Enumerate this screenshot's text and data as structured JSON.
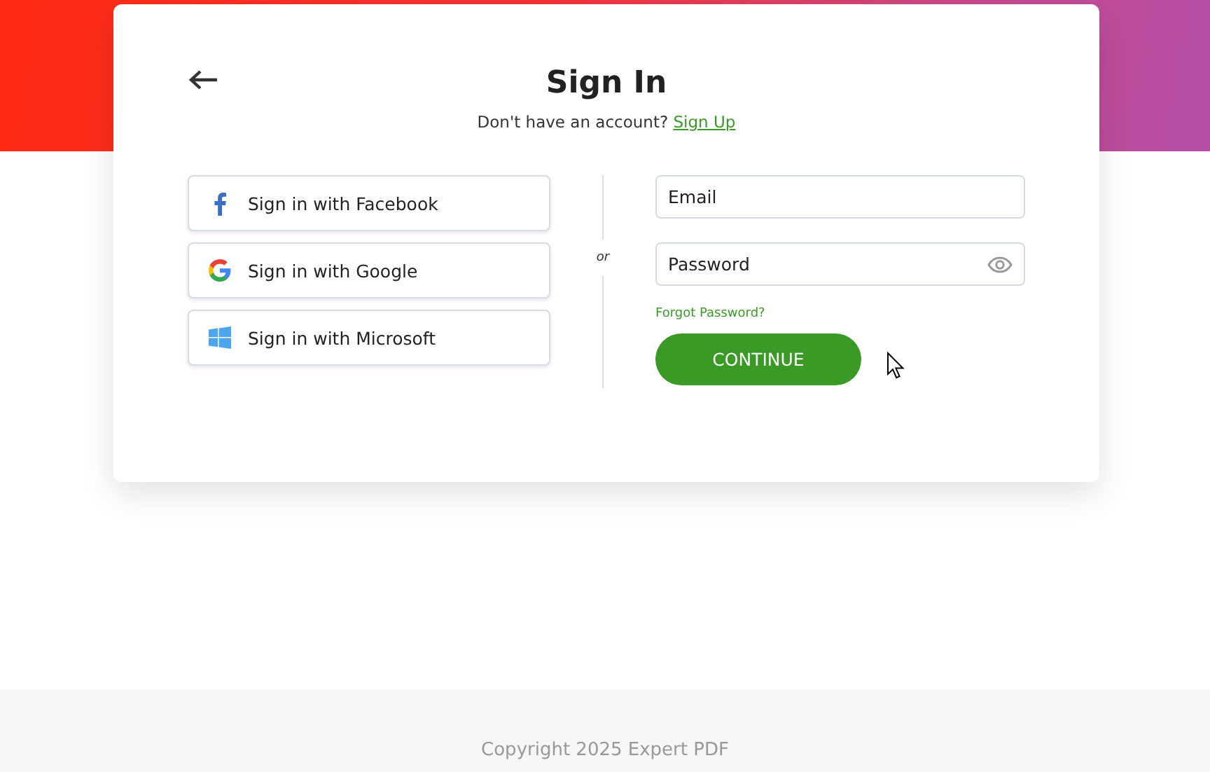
{
  "title": "Sign In",
  "signup_prompt": {
    "text": "Don't have an account?",
    "link": "Sign Up"
  },
  "social_buttons": [
    {
      "kind": "facebook",
      "label": "Sign in with Facebook"
    },
    {
      "kind": "google",
      "label": "Sign in with Google"
    },
    {
      "kind": "microsoft",
      "label": "Sign in with Microsoft"
    }
  ],
  "divider_label": "or",
  "email": {
    "placeholder": "Email"
  },
  "password": {
    "placeholder": "Password"
  },
  "forgot_link": "Forgot Password?",
  "continue_button": "CONTINUE",
  "footer": "Copyright 2025 Expert PDF"
}
